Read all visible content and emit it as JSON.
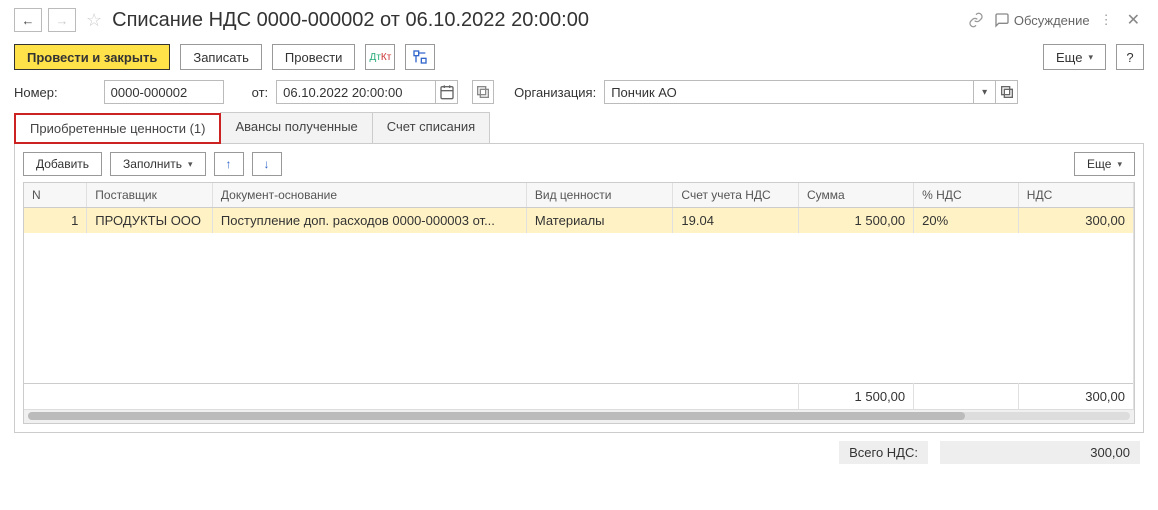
{
  "title": "Списание НДС 0000-000002 от 06.10.2022 20:00:00",
  "discuss_label": "Обсуждение",
  "cmd": {
    "post_close": "Провести и закрыть",
    "write": "Записать",
    "post": "Провести",
    "more": "Еще",
    "help": "?"
  },
  "fields": {
    "number_label": "Номер:",
    "number_value": "0000-000002",
    "from_label": "от:",
    "date_value": "06.10.2022 20:00:00",
    "org_label": "Организация:",
    "org_value": "Пончик АО"
  },
  "tabs": {
    "t1": "Приобретенные ценности (1)",
    "t2": "Авансы полученные",
    "t3": "Счет списания"
  },
  "tbl_cmd": {
    "add": "Добавить",
    "fill": "Заполнить",
    "more": "Еще"
  },
  "columns": {
    "n": "N",
    "supplier": "Поставщик",
    "doc": "Документ-основание",
    "type": "Вид ценности",
    "acct": "Счет учета НДС",
    "sum": "Сумма",
    "pct": "% НДС",
    "nds": "НДС"
  },
  "rows": [
    {
      "n": "1",
      "supplier": "ПРОДУКТЫ ООО",
      "doc": "Поступление доп. расходов 0000-000003 от...",
      "type": "Материалы",
      "acct": "19.04",
      "sum": "1 500,00",
      "pct": "20%",
      "nds": "300,00"
    }
  ],
  "totals": {
    "sum": "1 500,00",
    "nds": "300,00"
  },
  "footer": {
    "label": "Всего НДС:",
    "value": "300,00"
  }
}
